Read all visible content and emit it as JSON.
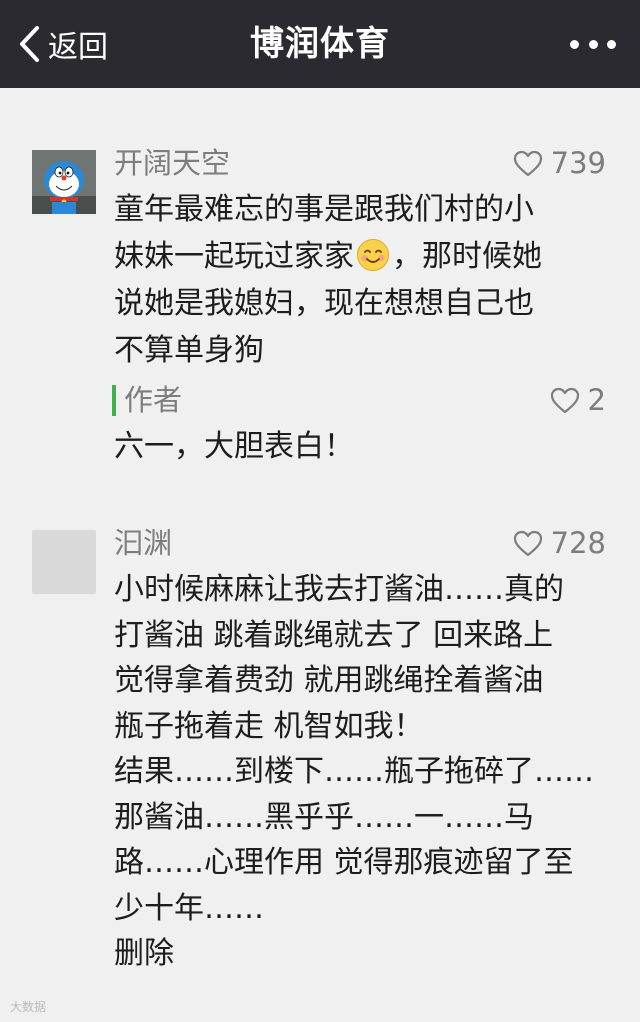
{
  "nav": {
    "back_label": "返回",
    "title": "博润体育"
  },
  "comments": [
    {
      "user": "开阔天空",
      "likes": "739",
      "text_before_emoji": "童年最难忘的事是跟我们村的小\n妹妹一起玩过家家",
      "text_after_emoji": "，那时候她\n说她是我媳妇，现在想想自己也\n不算单身狗",
      "author_reply": {
        "label": "作者",
        "likes": "2",
        "text": "六一，大胆表白！"
      }
    },
    {
      "user": "汩渊",
      "likes": "728",
      "text": "小时候麻麻让我去打酱油……真的\n打酱油 跳着跳绳就去了 回来路上\n觉得拿着费劲 就用跳绳拴着酱油\n瓶子拖着走 机智如我！\n结果……到楼下……瓶子拖碎了……\n那酱油……黑乎乎……一……马\n路……心理作用 觉得那痕迹留了至\n少十年……\n删除"
    }
  ],
  "icons": {
    "back": "chevron-left-icon",
    "more": "more-dots-icon",
    "like": "heart-outline-icon",
    "emoji": "smiling-face-emoji-icon"
  },
  "colors": {
    "topbar": "#2b2a30",
    "author_bar": "#3fb24a",
    "meta_text": "#7d7d7d",
    "body_text": "#1d1d1d"
  },
  "watermark": "大数据"
}
